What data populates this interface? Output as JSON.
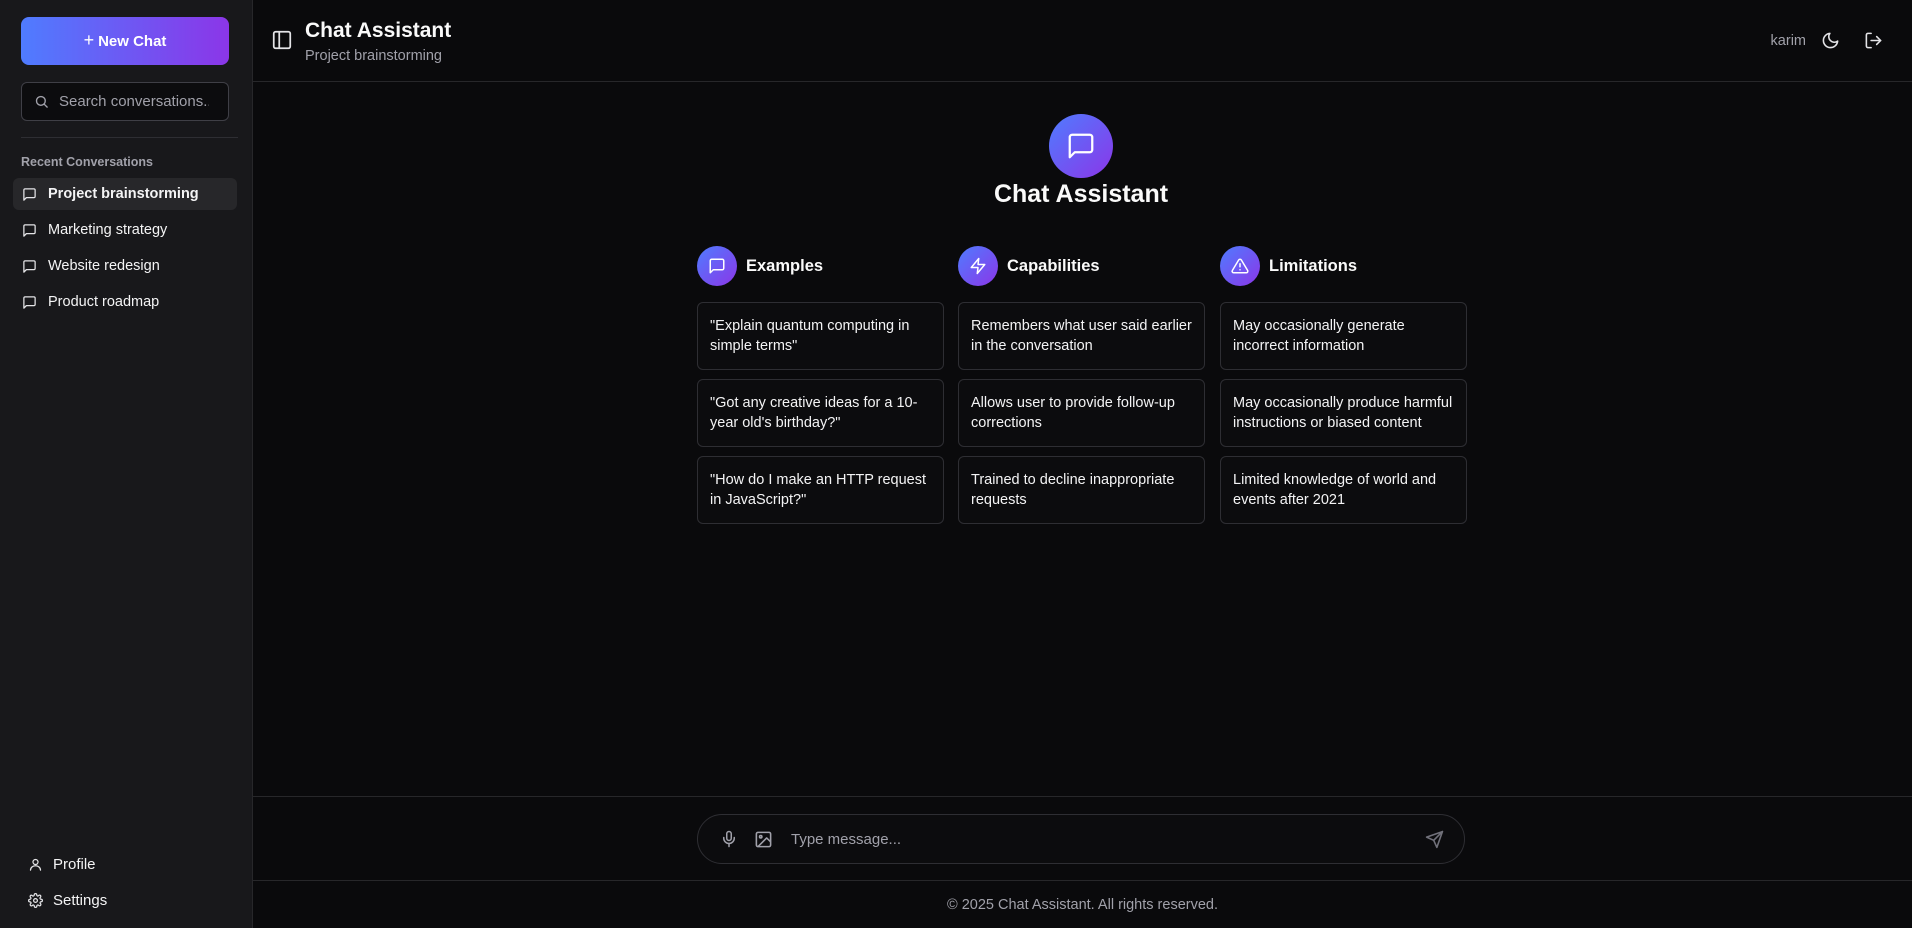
{
  "sidebar": {
    "new_chat_label": "New Chat",
    "search_placeholder": "Search conversations...",
    "recent_label": "Recent Conversations",
    "conversations": [
      {
        "label": "Project brainstorming",
        "active": true
      },
      {
        "label": "Marketing strategy"
      },
      {
        "label": "Website redesign"
      },
      {
        "label": "Product roadmap"
      }
    ],
    "profile_label": "Profile",
    "settings_label": "Settings"
  },
  "header": {
    "title": "Chat Assistant",
    "subtitle": "Project brainstorming",
    "username": "karim",
    "icons": [
      "sidebar-toggle-icon",
      "moon-icon",
      "logout-icon"
    ]
  },
  "main": {
    "hero_title": "Chat Assistant",
    "hero_icon": "message-square-icon",
    "columns": [
      {
        "title": "Examples",
        "icon": "message-square-icon",
        "items": [
          "\"Explain quantum computing in simple terms\"",
          "\"Got any creative ideas for a 10-year old's birthday?\"",
          "\"How do I make an HTTP request in JavaScript?\""
        ]
      },
      {
        "title": "Capabilities",
        "icon": "lightning-icon",
        "items": [
          "Remembers what user said earlier in the conversation",
          "Allows user to provide follow-up corrections",
          "Trained to decline inappropriate requests"
        ]
      },
      {
        "title": "Limitations",
        "icon": "warning-triangle-icon",
        "items": [
          "May occasionally generate incorrect information",
          "May occasionally produce harmful instructions or biased content",
          "Limited knowledge of world and events after 2021"
        ]
      }
    ]
  },
  "composer": {
    "placeholder": "Type message...",
    "value": ""
  },
  "footer": {
    "text": "© 2025 Chat Assistant. All rights reserved."
  },
  "colors": {
    "background": "#0a0a0c",
    "sidebar": "#18181b",
    "accent_start": "#4f7cff",
    "accent_end": "#8b36e8",
    "border": "#27272a",
    "muted_text": "#a1a1aa"
  }
}
